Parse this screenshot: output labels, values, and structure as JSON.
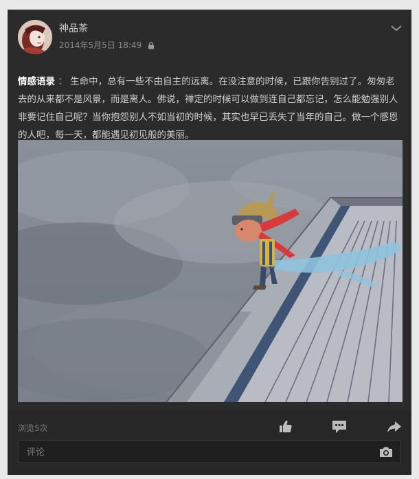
{
  "post": {
    "author": "神品茶",
    "timestamp": "2014年5月5日 18:49",
    "privacy_icon": "lock-icon",
    "menu_icon": "chevron-down-icon",
    "content_label": "情感语录",
    "content_sep": "：",
    "content_text": "生命中，总有一些不由自主的远离。在没注意的时候，已跟你告别过了。匆匆老去的从来都不是风景，而是离人。佛说，禅定的时候可以做到连自己都忘记，怎么能勉强别人非要记住自己呢？当你抱怨别人不如当初的时候，其实也早已丢失了当年的自己。做一个感恩的人吧，每一天，都能遇见初见般的美丽。"
  },
  "footer": {
    "views": "浏览5次",
    "like_icon": "thumbs-up-icon",
    "comment_icon": "comment-icon",
    "share_icon": "share-icon",
    "comment_placeholder": "评论",
    "camera_icon": "camera-icon"
  },
  "colors": {
    "card_bg": "#2b2b2b",
    "page_bg": "#e9e9e9",
    "text": "#cfcfcf",
    "muted": "#8a8a8a"
  }
}
